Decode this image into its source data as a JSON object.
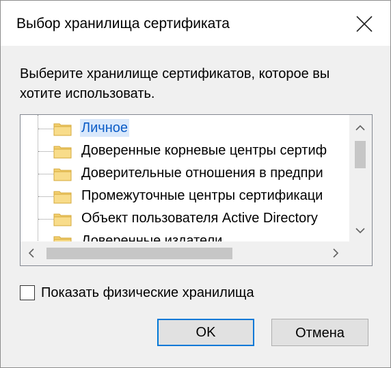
{
  "dialog": {
    "title": "Выбор хранилища сертификата",
    "prompt": "Выберите хранилище сертификатов, которое вы хотите использовать."
  },
  "stores": [
    {
      "label": "Личное",
      "selected": true
    },
    {
      "label": "Доверенные корневые центры сертиф",
      "selected": false
    },
    {
      "label": "Доверительные отношения в предпри",
      "selected": false
    },
    {
      "label": "Промежуточные центры сертификаци",
      "selected": false
    },
    {
      "label": "Объект пользователя Active Directory",
      "selected": false
    },
    {
      "label": "Доверенные издатели",
      "selected": false
    }
  ],
  "show_physical": {
    "label": "Показать физические хранилища",
    "checked": false
  },
  "buttons": {
    "ok": "OK",
    "cancel": "Отмена"
  },
  "colors": {
    "selection_bg": "#d9e8fb",
    "selection_text": "#0b5cc7",
    "folder_fill": "#f3d070",
    "default_border": "#0078d7"
  }
}
